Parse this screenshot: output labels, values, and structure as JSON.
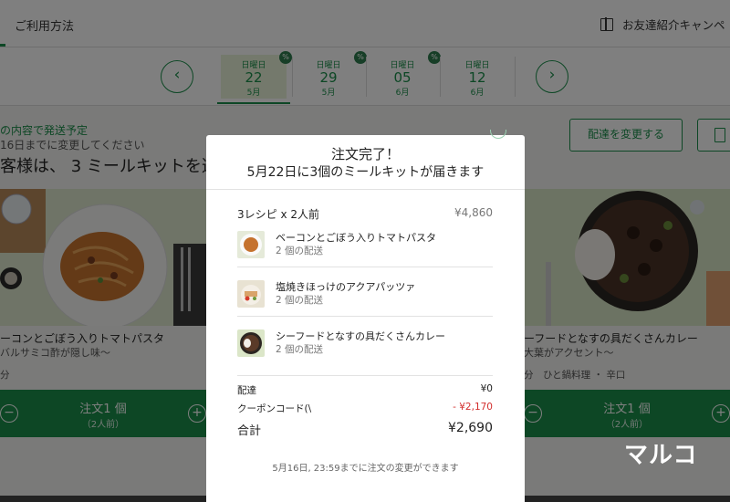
{
  "header": {
    "howto_label": "ご利用方法",
    "referral_label": "お友達紹介キャンペ"
  },
  "dates": [
    {
      "dow": "日曜日",
      "day": "22",
      "month": "5月",
      "badge": "%",
      "active": true
    },
    {
      "dow": "日曜日",
      "day": "29",
      "month": "5月",
      "badge": "%",
      "active": false
    },
    {
      "dow": "日曜日",
      "day": "05",
      "month": "6月",
      "badge": "%",
      "active": false
    },
    {
      "dow": "日曜日",
      "day": "12",
      "month": "6月",
      "badge": "",
      "active": false
    }
  ],
  "nav": {
    "prev": "‹",
    "next": "›"
  },
  "info": {
    "shipping": "の内容で発送予定",
    "deadline": "16日までに変更してください",
    "headline": "客様は、 3 ミールキットを選"
  },
  "buttons": {
    "change_delivery": "配達を変更する"
  },
  "cards": [
    {
      "title": "ーコンとごぼう入りトマトパスタ",
      "sub": "バルサミコ酢が隠し味〜",
      "meta": "分",
      "order_label": "注文1 個",
      "order_sub": "（2人前）"
    },
    {
      "title": "ーフードとなすの具だくさんカレー",
      "sub": "大葉がアクセント〜",
      "meta": "分　ひと鍋料理 ・ 辛口",
      "order_label": "注文1 個",
      "order_sub": "（2人前）"
    }
  ],
  "controls": {
    "minus": "−",
    "plus": "+"
  },
  "modal": {
    "title": "注文完了！",
    "subtitle": "5月22日に3個のミールキットが届きます",
    "summary_label": "3レシピ x 2人前",
    "summary_price": "¥4,860",
    "recipes": [
      {
        "name": "ベーコンとごぼう入りトマトパスタ",
        "qty": "2 個の配送"
      },
      {
        "name": "塩焼きほっけのアクアパッツァ",
        "qty": "2 個の配送"
      },
      {
        "name": "シーフードとなすの具だくさんカレー",
        "qty": "2 個の配送"
      }
    ],
    "shipping_label": "配達",
    "shipping_value": "¥0",
    "coupon_label": "クーポンコード(\\",
    "coupon_value": "- ¥2,170",
    "total_label": "合計",
    "total_value": "¥2,690",
    "note": "5月16日, 23:59までに注文の変更ができます"
  },
  "watermark": "マルコ"
}
